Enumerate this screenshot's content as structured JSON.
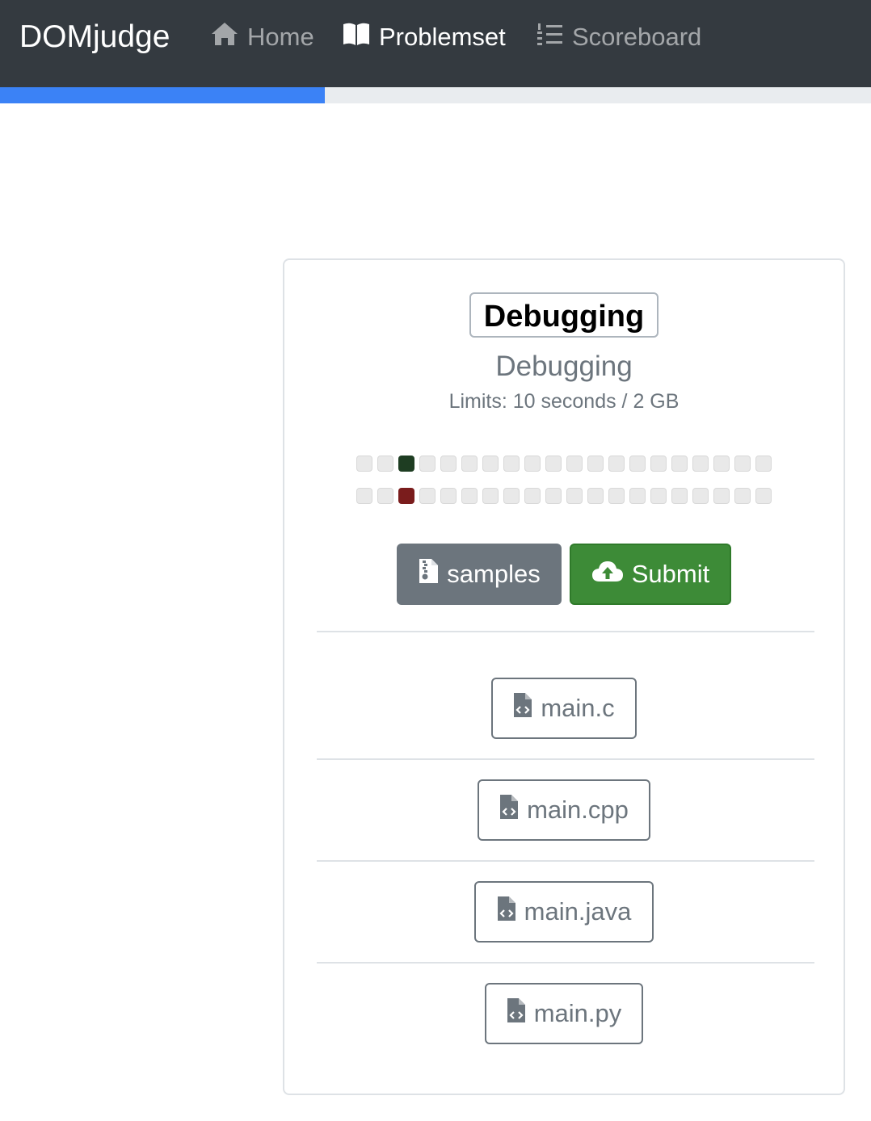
{
  "navbar": {
    "brand": "DOMjudge",
    "links": [
      {
        "label": "Home",
        "icon": "home-icon",
        "active": false
      },
      {
        "label": "Problemset",
        "icon": "book-open-icon",
        "active": true
      },
      {
        "label": "Scoreboard",
        "icon": "list-ol-icon",
        "active": false
      }
    ]
  },
  "progress": {
    "fraction": 0.373,
    "color": "#3b82f6"
  },
  "problem": {
    "badge": "Debugging",
    "name": "Debugging",
    "limits": "Limits: 10 seconds / 2 GB",
    "status_rows": [
      {
        "solved_index": 2,
        "solved_color": "#1e3d22"
      },
      {
        "solved_index": 2,
        "solved_color": "#7a1c1c"
      }
    ],
    "cells_per_row": 20,
    "buttons": {
      "samples": {
        "label": "samples",
        "icon": "file-archive-icon",
        "color": "#6c757d"
      },
      "submit": {
        "label": "Submit",
        "icon": "cloud-upload-icon",
        "color": "#3d8b37"
      }
    },
    "files": [
      {
        "label": "main.c",
        "icon": "file-code-icon"
      },
      {
        "label": "main.cpp",
        "icon": "file-code-icon"
      },
      {
        "label": "main.java",
        "icon": "file-code-icon"
      },
      {
        "label": "main.py",
        "icon": "file-code-icon"
      }
    ]
  }
}
